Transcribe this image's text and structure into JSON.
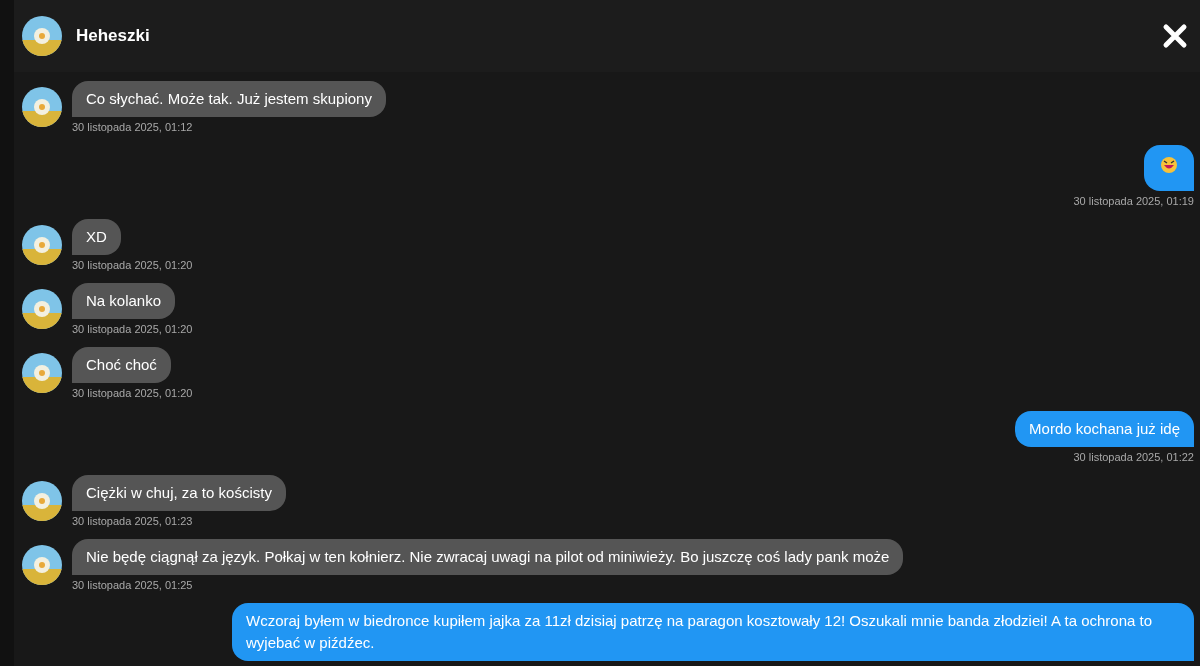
{
  "header": {
    "name": "Heheszki"
  },
  "messages": [
    {
      "kind": "text",
      "outgoing": false,
      "text": "Co słychać. Może tak. Już jestem skupiony",
      "time": "30 listopada 2025, 01:12"
    },
    {
      "kind": "emoji",
      "outgoing": true,
      "time": "30 listopada 2025, 01:19"
    },
    {
      "kind": "text",
      "outgoing": false,
      "text": "XD",
      "time": "30 listopada 2025, 01:20"
    },
    {
      "kind": "text",
      "outgoing": false,
      "text": "Na kolanko",
      "time": "30 listopada 2025, 01:20"
    },
    {
      "kind": "text",
      "outgoing": false,
      "text": "Choć choć",
      "time": "30 listopada 2025, 01:20"
    },
    {
      "kind": "text",
      "outgoing": true,
      "text": "Mordo kochana już idę",
      "time": "30 listopada 2025, 01:22"
    },
    {
      "kind": "text",
      "outgoing": false,
      "text": "Ciężki w chuj, za to kościsty",
      "time": "30 listopada 2025, 01:23"
    },
    {
      "kind": "text",
      "outgoing": false,
      "text": "Nie będę ciągnął za język. Połkaj w ten kołnierz. Nie zwracaj uwagi na pilot od miniwieży. Bo juszczę coś lady pank może",
      "time": "30 listopada 2025, 01:25"
    },
    {
      "kind": "text",
      "outgoing": true,
      "text": "Wczoraj byłem w biedronce kupiłem jajka za 11zł dzisiaj patrzę na paragon kosztowały 12! Oszukali mnie banda złodziei! A ta ochrona to wyjebać w piźdźec."
    }
  ]
}
